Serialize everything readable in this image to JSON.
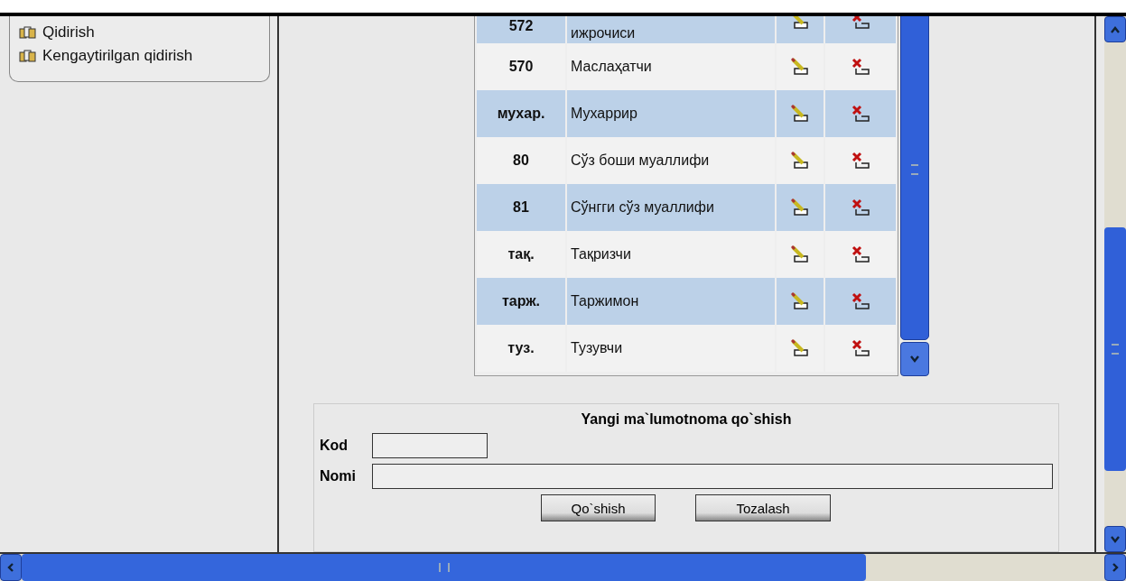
{
  "sidebar": {
    "items": [
      {
        "label": "Qidirish"
      },
      {
        "label": "Kengaytirilgan qidirish"
      }
    ]
  },
  "table": {
    "rows": [
      {
        "code": "572",
        "name": "ижрочиси"
      },
      {
        "code": "570",
        "name": "Маслаҳатчи"
      },
      {
        "code": "мухар.",
        "name": "Мухаррир"
      },
      {
        "code": "80",
        "name": "Сўз боши муаллифи"
      },
      {
        "code": "81",
        "name": "Сўнгги сўз муаллифи"
      },
      {
        "code": "тақ.",
        "name": "Тақризчи"
      },
      {
        "code": "тарж.",
        "name": "Таржимон"
      },
      {
        "code": "туз.",
        "name": "Тузувчи"
      }
    ]
  },
  "form": {
    "title": "Yangi ma`lumotnoma qo`shish",
    "fields": [
      {
        "label": "Kod",
        "kind": "short"
      },
      {
        "label": "Nomi",
        "kind": "wide"
      }
    ],
    "buttons": [
      "Qo`shish",
      "Tozalash"
    ]
  }
}
